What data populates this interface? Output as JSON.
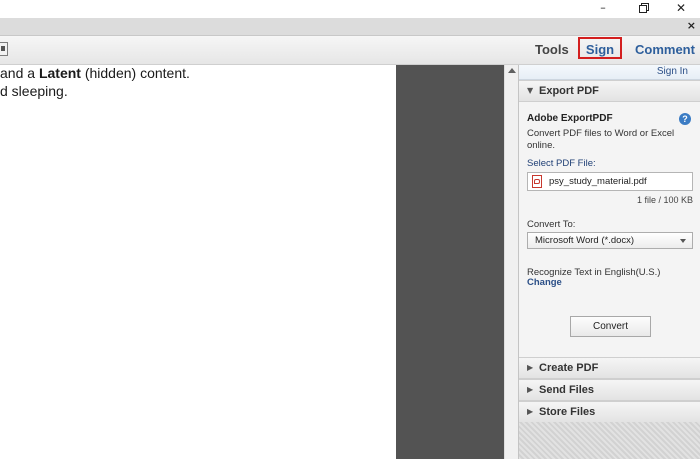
{
  "window": {
    "minimize_glyph": "–",
    "close_glyph": "✕",
    "doc_close_glyph": "×"
  },
  "toolbar": {
    "tools": "Tools",
    "sign": "Sign",
    "comment": "Comment"
  },
  "document": {
    "line1_prefix": "and a ",
    "line1_bold": "Latent",
    "line1_suffix": " (hidden) content.",
    "line2": "d sleeping."
  },
  "pane": {
    "sign_in": "Sign In",
    "export_pdf": {
      "header": "Export PDF",
      "title": "Adobe ExportPDF",
      "help": "?",
      "description": "Convert PDF files to Word or Excel online.",
      "select_label": "Select PDF File:",
      "file_name": "psy_study_material.pdf",
      "file_count": "1 file / 100 KB",
      "convert_to_label": "Convert To:",
      "convert_to_value": "Microsoft Word (*.docx)",
      "recognize_text": "Recognize Text in English(U.S.)",
      "change_link": "Change",
      "convert_button": "Convert"
    },
    "sections": {
      "create_pdf": "Create PDF",
      "send_files": "Send Files",
      "store_files": "Store Files"
    },
    "arrow_expanded": "▼",
    "arrow_collapsed": "▶"
  },
  "colors": {
    "accent_blue": "#2e5f9c",
    "highlight_red": "#d31f1f",
    "gray_canvas": "#535353"
  }
}
